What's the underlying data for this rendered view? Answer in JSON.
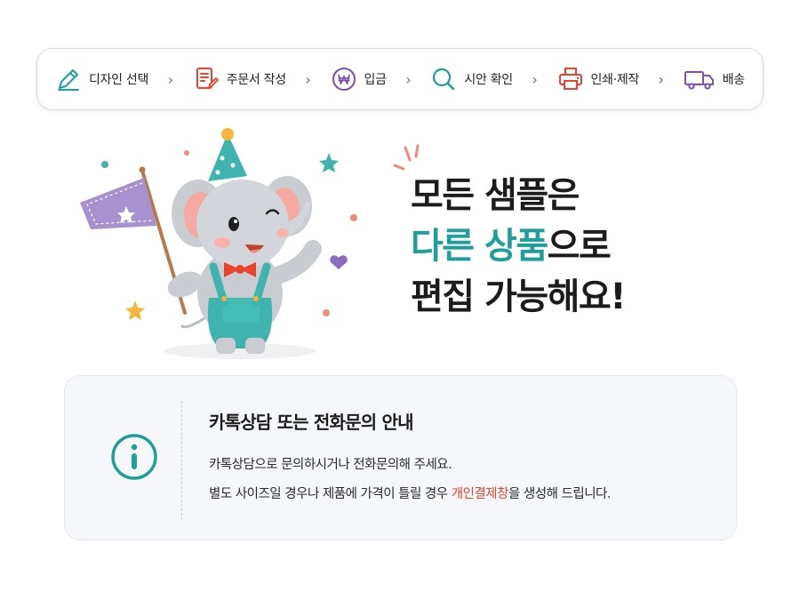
{
  "steps": [
    {
      "label": "디자인 선택",
      "icon": "pencil-icon",
      "color": "#1f9e9a"
    },
    {
      "label": "주문서 작성",
      "icon": "order-form-icon",
      "color": "#e8442c"
    },
    {
      "label": "입금",
      "icon": "won-coin-icon",
      "color": "#7b4fb0"
    },
    {
      "label": "시안 확인",
      "icon": "magnifier-icon",
      "color": "#1f9e9a"
    },
    {
      "label": "인쇄·제작",
      "icon": "printer-icon",
      "color": "#e8442c"
    },
    {
      "label": "배송",
      "icon": "truck-icon",
      "color": "#7b4fb0"
    }
  ],
  "chevron": "›",
  "headline": {
    "line1": "모든 샘플은",
    "line2_accent": "다른 상품",
    "line2_rest": "으로",
    "line3": "편집 가능해요!"
  },
  "info": {
    "title": "카톡상담 또는 전화문의 안내",
    "line1": "카톡상담으로 문의하시거나 전화문의해 주세요.",
    "line2_before": "별도 사이즈일 경우나 제품에 가격이 틀릴 경우 ",
    "line2_highlight": "개인결제창",
    "line2_after": "을 생성해 드립니다.",
    "icon": "info-icon"
  },
  "colors": {
    "accent_teal": "#1f9e9a",
    "accent_red": "#e8442c",
    "accent_purple": "#7b4fb0"
  }
}
